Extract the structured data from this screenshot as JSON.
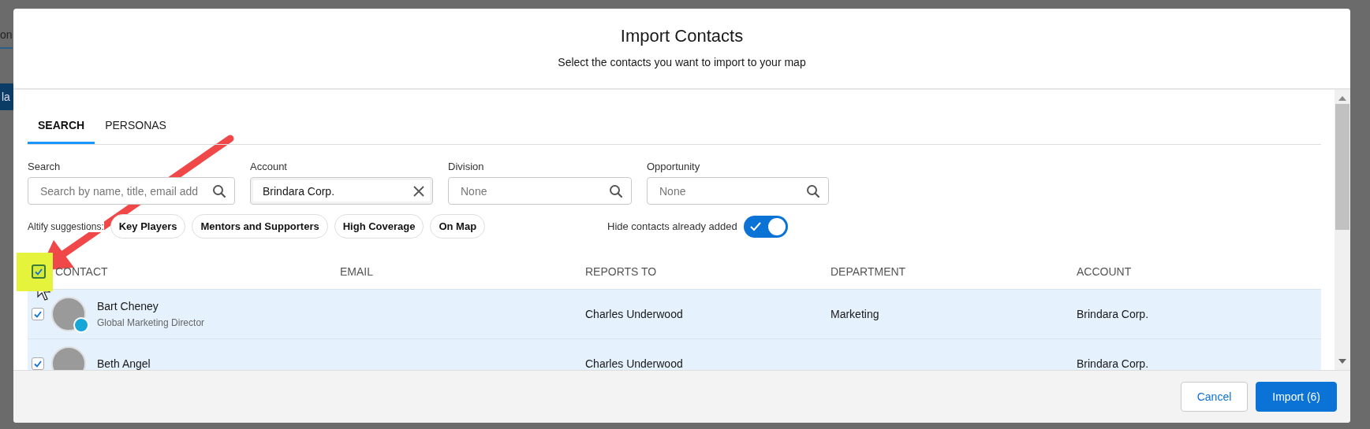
{
  "background": {
    "tab_fragment": "on",
    "button_fragment": "la"
  },
  "dialog": {
    "title": "Import Contacts",
    "subtitle": "Select the contacts you want to import to your map"
  },
  "tabs": [
    {
      "label": "SEARCH",
      "selected": true
    },
    {
      "label": "PERSONAS",
      "selected": false
    }
  ],
  "filters": [
    {
      "label": "Search",
      "placeholder": "Search by name, title, email add",
      "kind": "search"
    },
    {
      "label": "Account",
      "value": "Brindara Corp.",
      "kind": "clear"
    },
    {
      "label": "Division",
      "placeholder": "None",
      "kind": "search"
    },
    {
      "label": "Opportunity",
      "placeholder": "None",
      "kind": "search"
    }
  ],
  "suggestions": {
    "label": "Altify suggestions:",
    "chips": [
      "Key Players",
      "Mentors and Supporters",
      "High Coverage",
      "On Map"
    ]
  },
  "hide_added": {
    "label": "Hide contacts already added",
    "on": true
  },
  "table": {
    "all_checked": true,
    "columns": [
      "CONTACT",
      "EMAIL",
      "REPORTS TO",
      "DEPARTMENT",
      "ACCOUNT"
    ],
    "rows": [
      {
        "checked": true,
        "name": "Bart Cheney",
        "title": "Global Marketing Director",
        "key_player": true,
        "reports_to": "Charles Underwood",
        "department": "Marketing",
        "account": "Brindara Corp."
      },
      {
        "checked": true,
        "name": "Beth Angel",
        "key_player": false,
        "reports_to": "Charles Underwood",
        "account": "Brindara Corp."
      }
    ]
  },
  "buttons": [
    {
      "label": "Cancel",
      "kind": "secondary"
    },
    {
      "label": "Import (6)",
      "kind": "primary"
    }
  ]
}
